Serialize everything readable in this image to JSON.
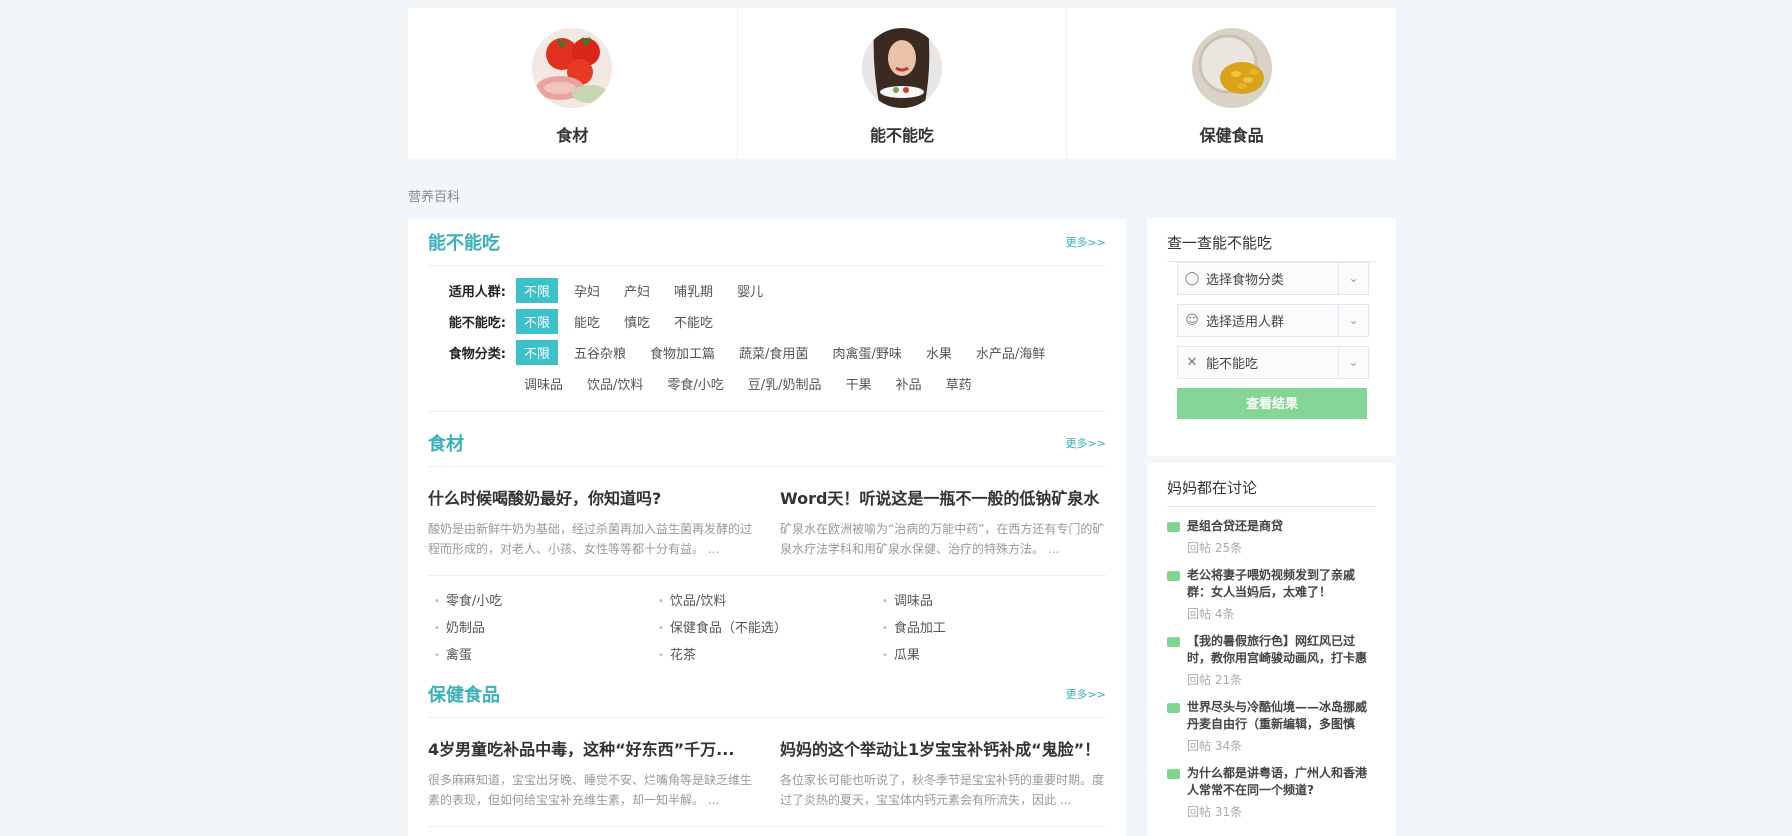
{
  "top_cards": [
    {
      "label": "食材",
      "image": "tomato-ham-food-photo"
    },
    {
      "label": "能不能吃",
      "image": "woman-eating-photo"
    },
    {
      "label": "保健食品",
      "image": "supplement-capsules-photo"
    }
  ],
  "breadcrumb": "营养百科",
  "can_eat": {
    "title": "能不能吃",
    "more": "更多>>",
    "rows": [
      {
        "label": "适用人群:",
        "tags": [
          "不限",
          "孕妇",
          "产妇",
          "哺乳期",
          "婴儿"
        ]
      },
      {
        "label": "能不能吃:",
        "tags": [
          "不限",
          "能吃",
          "慎吃",
          "不能吃"
        ]
      },
      {
        "label": "食物分类:",
        "tags": [
          "不限",
          "五谷杂粮",
          "食物加工篇",
          "蔬菜/食用菌",
          "肉禽蛋/野味",
          "水果",
          "水产品/海鲜"
        ]
      }
    ],
    "row_cont_tags": [
      "调味品",
      "饮品/饮料",
      "零食/小吃",
      "豆/乳/奶制品",
      "干果",
      "补品",
      "草药"
    ]
  },
  "ingredients": {
    "title": "食材",
    "more": "更多>>",
    "articles": [
      {
        "title": "什么时候喝酸奶最好，你知道吗?",
        "desc": "酸奶是由新鲜牛奶为基础，经过杀菌再加入益生菌再发酵的过程而形成的，对老人、小孩、女性等等都十分有益。 ..."
      },
      {
        "title": "Word天！听说这是一瓶不一般的低钠矿泉水",
        "desc": "矿泉水在欧洲被喻为“治病的万能中药”，在西方还有专门的矿泉水疗法学科和用矿泉水保健、治疗的特殊方法。 ..."
      }
    ],
    "categories": [
      "零食/小吃",
      "饮品/饮料",
      "调味品",
      "奶制品",
      "保健食品（不能选）",
      "食品加工",
      "禽蛋",
      "花茶",
      "瓜果"
    ]
  },
  "health_food": {
    "title": "保健食品",
    "more": "更多>>",
    "articles": [
      {
        "title": "4岁男童吃补品中毒，这种“好东西”千万...",
        "desc": "很多麻麻知道，宝宝出牙晚、睡觉不安、烂嘴角等是缺乏维生素的表现，但如何给宝宝补充维生素，却一知半解。 ..."
      },
      {
        "title": "妈妈的这个举动让1岁宝宝补钙补成“鬼脸”！",
        "desc": "各位家长可能也听说了，秋冬季节是宝宝补钙的重要时期。度过了炎热的夏天，宝宝体内钙元素会有所流失，因此 ..."
      }
    ]
  },
  "check_panel": {
    "title": "查一查能不能吃",
    "selects": [
      {
        "label": "选择食物分类",
        "icon": "apple-icon"
      },
      {
        "label": "选择适用人群",
        "icon": "person-icon"
      },
      {
        "label": "能不能吃",
        "icon": "utensils-icon"
      }
    ],
    "button": "查看结果"
  },
  "discuss_panel": {
    "title": "妈妈都在讨论",
    "items": [
      {
        "title": "是组合贷还是商贷",
        "reply": "回帖 25条"
      },
      {
        "title": "老公将妻子喂奶视频发到了亲戚群：女人当妈后，太难了！",
        "reply": "回帖 4条"
      },
      {
        "title": "【我的暑假旅行色】网红风已过时，教你用宫崎骏动画风，打卡惠",
        "reply": "回帖 21条"
      },
      {
        "title": "世界尽头与冷酷仙境——冰岛挪威丹麦自由行（重新编辑，多图慎",
        "reply": "回帖 34条"
      },
      {
        "title": "为什么都是讲粤语，广州人和香港人常常不在同一个频道?",
        "reply": "回帖 31条"
      }
    ]
  },
  "colors": {
    "accent": "#3ab0b9",
    "tag_active": "#3cc1c9",
    "button": "#85d696"
  }
}
